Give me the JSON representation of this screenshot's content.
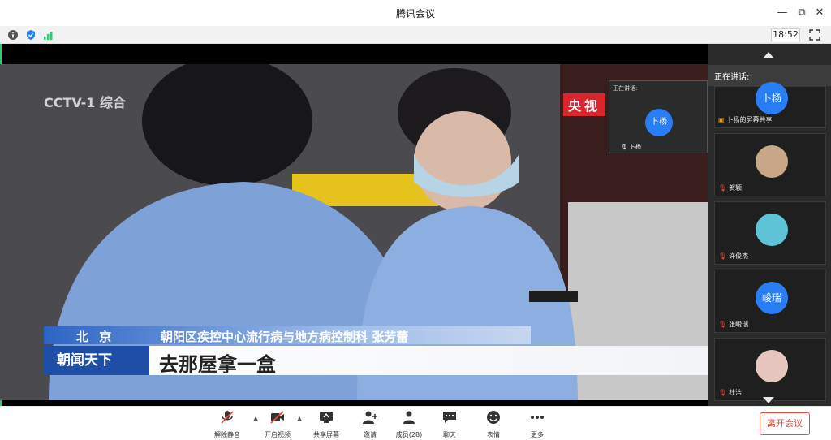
{
  "window": {
    "title": "腾讯会议"
  },
  "infobar": {
    "clock": "18:52"
  },
  "video": {
    "watermark": "CCTV-1 综合",
    "badge": "央视",
    "location": "北 京",
    "name_line": "朝阳区疾控中心流行病与地方病控制科 张芳蕾",
    "program": "朝闻天下",
    "subtitle": "去那屋拿一盒"
  },
  "speaker_thumb": {
    "header": "正在讲话:",
    "avatar_text": "卜杨",
    "name": "卜杨"
  },
  "right_panel": {
    "speaking_label": "正在讲话:",
    "tiles": [
      {
        "avatar_text": "卜杨",
        "label": "卜杨的屏幕共享"
      },
      {
        "avatar_text": "",
        "label": "贺颖"
      },
      {
        "avatar_text": "",
        "label": "许俊杰"
      },
      {
        "avatar_text": "峻瑞",
        "label": "张峻瑞"
      },
      {
        "avatar_text": "",
        "label": "杜洁"
      }
    ]
  },
  "toolbar": {
    "unmute": "解除静音",
    "video": "开启视频",
    "share": "共享屏幕",
    "invite": "邀请",
    "members": "成员(28)",
    "chat": "聊天",
    "emoji": "表情",
    "more": "更多",
    "leave": "离开会议"
  },
  "colors": {
    "accent": "#2a7ef5",
    "danger": "#e74c3c",
    "online": "#2ecc71"
  }
}
